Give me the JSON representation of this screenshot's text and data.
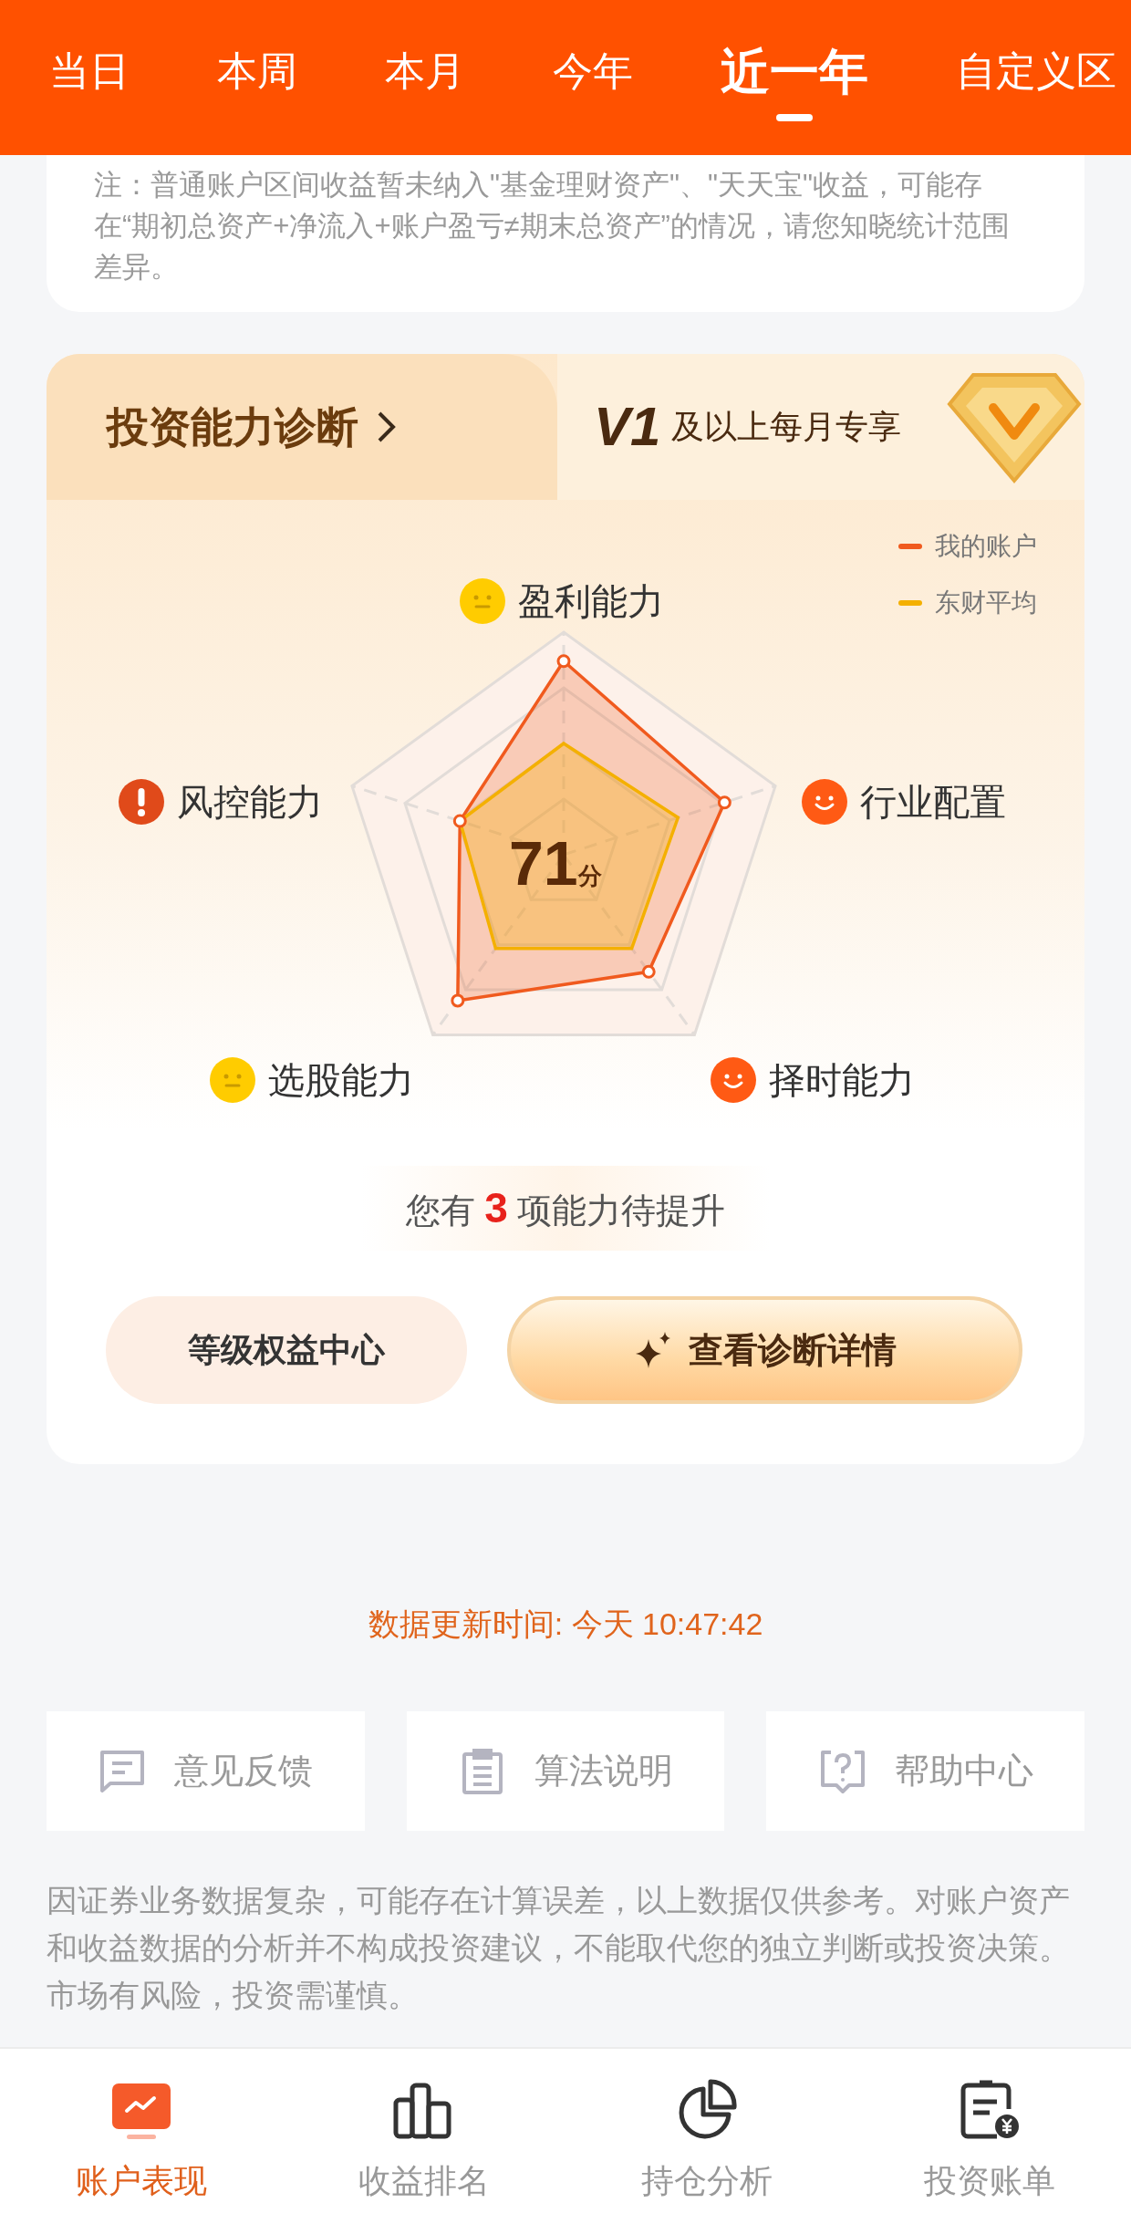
{
  "header_tabs": [
    {
      "label": "当日",
      "selected": false
    },
    {
      "label": "本周",
      "selected": false
    },
    {
      "label": "本月",
      "selected": false
    },
    {
      "label": "今年",
      "selected": false
    },
    {
      "label": "近一年",
      "selected": true
    },
    {
      "label": "自定义区",
      "selected": false
    }
  ],
  "note": "注：普通账户区间收益暂未纳入\"基金理财资产\"、\"天天宝\"收益，可能存在“期初总资产+净流入+账户盈亏≠期末总资产”的情况，请您知晓统计范围差异。",
  "diagnosis": {
    "title": "投资能力诊断",
    "vip_level": "V1",
    "vip_text": "及以上每月专享",
    "legend": [
      {
        "label": "我的账户",
        "color": "#f05a1e"
      },
      {
        "label": "东财平均",
        "color": "#f4b000"
      }
    ],
    "score": "71",
    "score_unit": "分",
    "axes": [
      {
        "label": "盈利能力",
        "kind": "neutral"
      },
      {
        "label": "行业配置",
        "kind": "good"
      },
      {
        "label": "择时能力",
        "kind": "good"
      },
      {
        "label": "选股能力",
        "kind": "neutral"
      },
      {
        "label": "风控能力",
        "kind": "warning"
      }
    ],
    "summary": "您有 **3** 项能力待提升",
    "buttons": [
      {
        "label": "等级权益中心",
        "kind": "secondary"
      },
      {
        "label": "查看诊断详情",
        "kind": "primary"
      }
    ]
  },
  "update_time": "数据更新时间: 今天 10:47:42",
  "links": [
    {
      "label": "意见反馈",
      "kind": "feedback"
    },
    {
      "label": "算法说明",
      "kind": "doc"
    },
    {
      "label": "帮助中心",
      "kind": "help"
    }
  ],
  "disclaimer": "因证券业务数据复杂，可能存在计算误差，以上数据仅供参考。对账户资产和收益数据的分析并不构成投资建议，不能取代您的独立判断或投资决策。市场有风险，投资需谨慎。",
  "bottom_nav": [
    {
      "label": "账户表现",
      "kind": "performance",
      "selected": true
    },
    {
      "label": "收益排名",
      "kind": "ranking",
      "selected": false
    },
    {
      "label": "持仓分析",
      "kind": "holdings",
      "selected": false
    },
    {
      "label": "投资账单",
      "kind": "bill",
      "selected": false
    }
  ]
}
